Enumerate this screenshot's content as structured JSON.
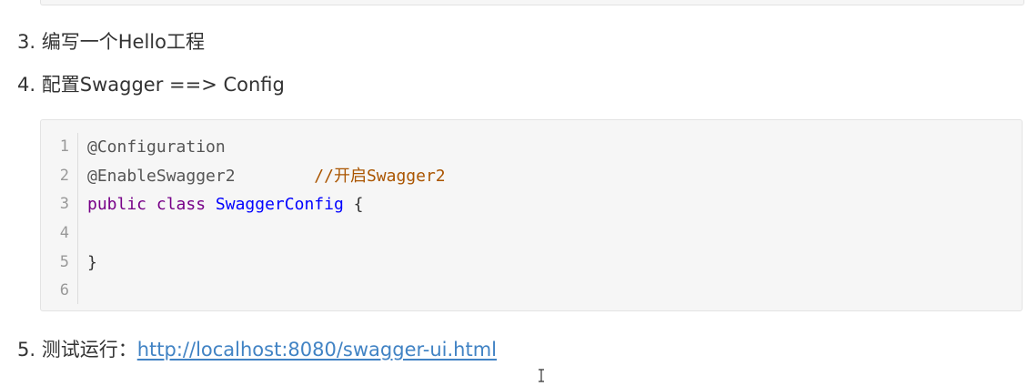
{
  "steps": [
    {
      "number": "3.",
      "text": "编写一个Hello工程"
    },
    {
      "number": "4.",
      "text": "配置Swagger ==> Config"
    },
    {
      "number": "5.",
      "text": "测试运行：",
      "link": "http://localhost:8080/swagger-ui.html"
    }
  ],
  "code": {
    "line_numbers": [
      "1",
      "2",
      "3",
      "4",
      "5",
      "6"
    ],
    "line1": {
      "annotation": "@Configuration"
    },
    "line2": {
      "annotation": "@EnableSwagger2",
      "spacing": "        ",
      "comment": "//开启Swagger2"
    },
    "line3": {
      "keyword1": "public",
      "keyword2": "class",
      "class_name": "SwaggerConfig",
      "brace": "{"
    },
    "line4": {
      "text": ""
    },
    "line5": {
      "text": "}"
    },
    "line6": {
      "text": ""
    }
  },
  "colors": {
    "link": "#4183c4",
    "keyword": "#770088",
    "class_name": "#0000ff",
    "comment": "#aa5500",
    "code_background": "#f6f6f6"
  },
  "icons": {
    "cursor": "text-cursor-icon"
  }
}
